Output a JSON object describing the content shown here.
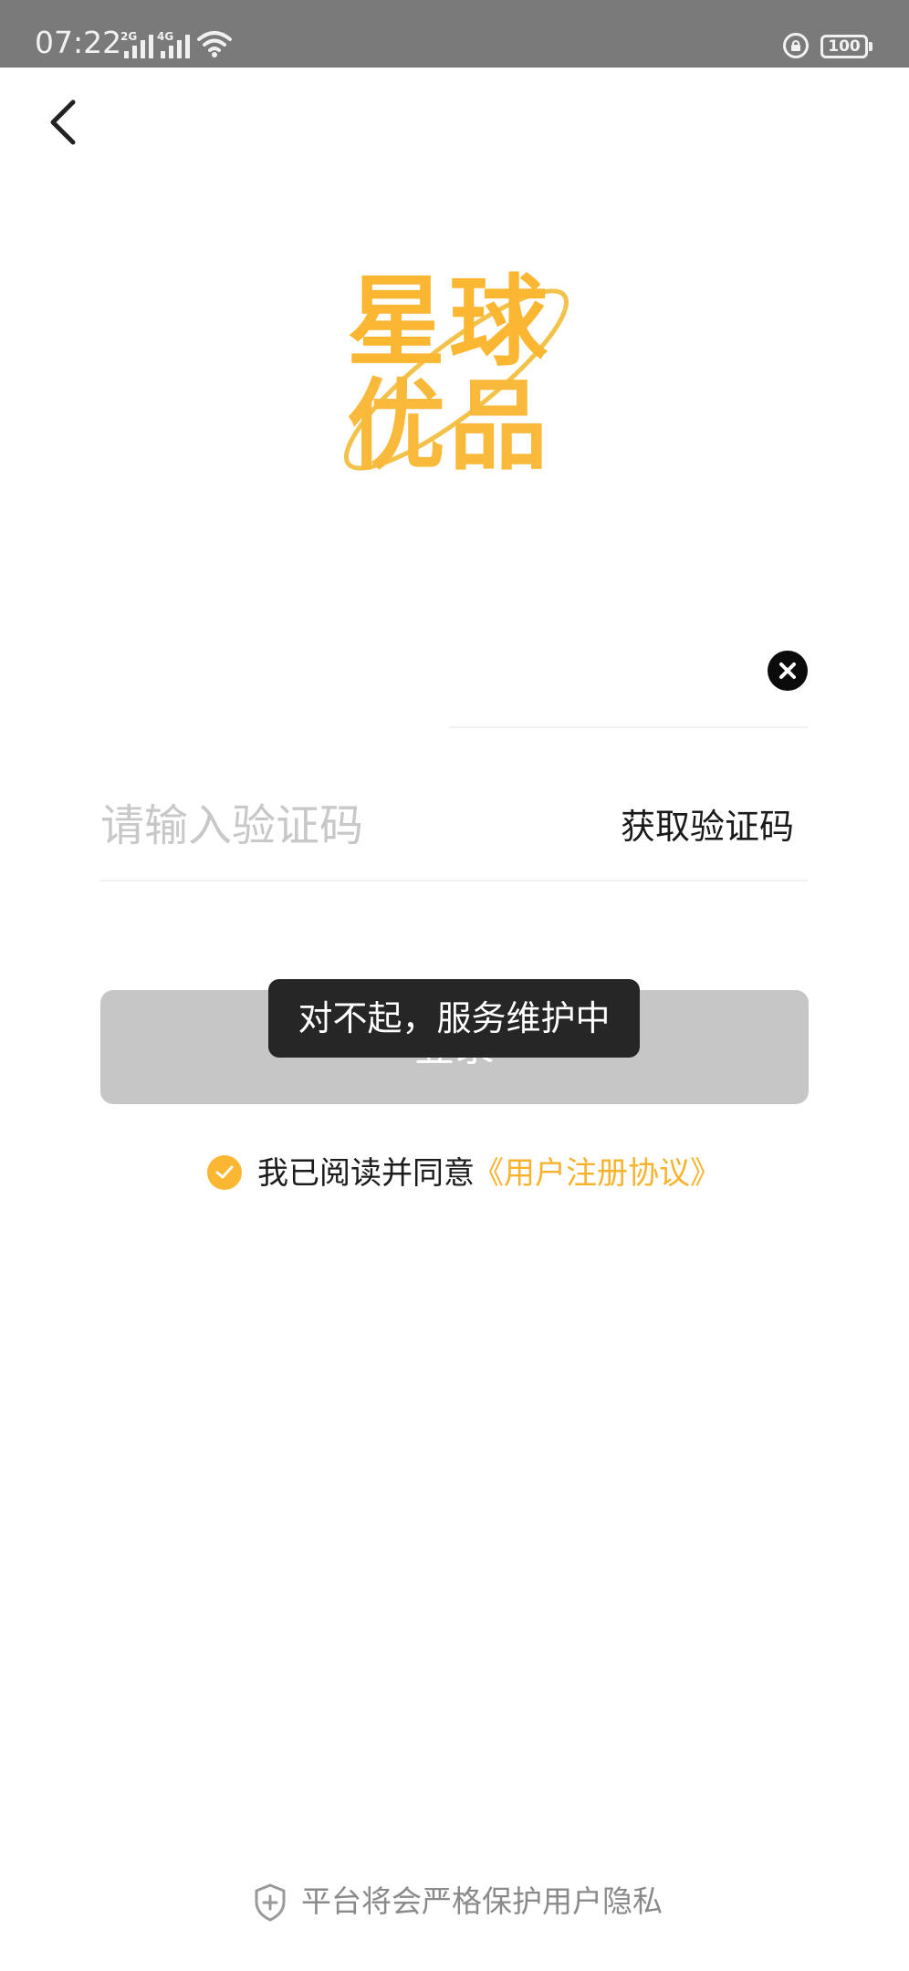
{
  "status_bar": {
    "time": "07:22",
    "signal1_tag": "2G",
    "signal2_tag": "4G",
    "battery": "100",
    "icons": [
      "wifi-icon",
      "rotation-lock-icon",
      "battery-icon"
    ]
  },
  "nav": {
    "back_icon": "chevron-left-icon"
  },
  "logo": {
    "line1": "星球",
    "line2": "优品",
    "color": "#fbb632"
  },
  "form": {
    "phone_value": "",
    "clear_icon": "close-icon",
    "code_placeholder": "请输入验证码",
    "get_code_label": "获取验证码",
    "login_label": "登录"
  },
  "toast": {
    "message": "对不起，服务维护中"
  },
  "agreement": {
    "checked": true,
    "text": "我已阅读并同意",
    "link": "《用户注册协议》",
    "accent": "#f7b32e"
  },
  "footer": {
    "privacy_text": "平台将会严格保护用户隐私",
    "icon": "shield-icon"
  }
}
